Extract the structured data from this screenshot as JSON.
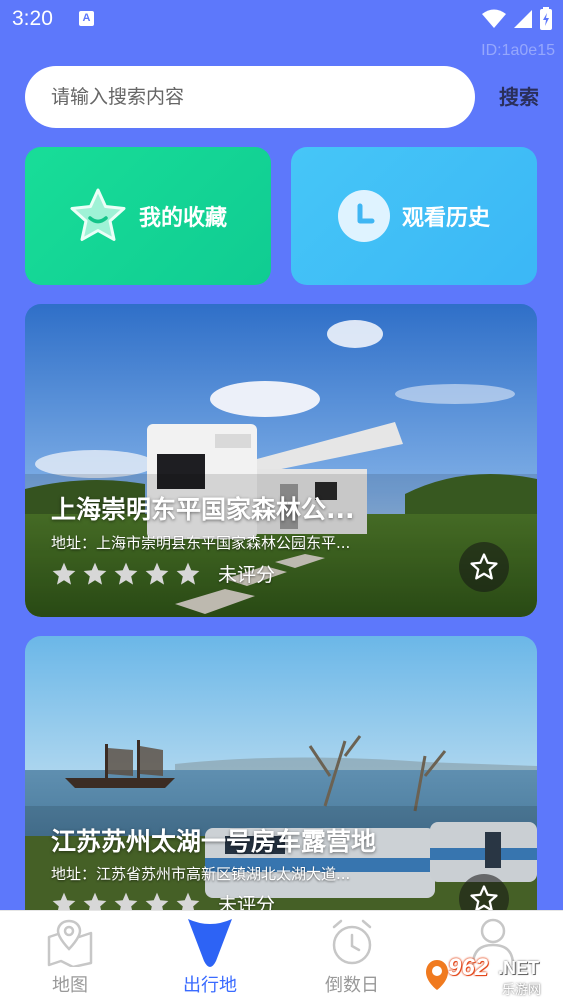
{
  "status_bar": {
    "time": "3:20",
    "notification_letter": "A",
    "icons": [
      "wifi-icon",
      "signal-icon",
      "battery-icon"
    ]
  },
  "device_id": "ID:1a0e15",
  "search": {
    "placeholder": "请输入搜索内容",
    "value": "",
    "button_label": "搜索"
  },
  "quick_actions": {
    "favorites_label": "我的收藏",
    "history_label": "观看历史"
  },
  "campsites": [
    {
      "title": "上海崇明东平国家森林公...",
      "address": "地址：上海市崇明县东平国家森林公园东平...",
      "rating_stars": 0,
      "rating_max": 5,
      "rating_text": "未评分"
    },
    {
      "title": "江苏苏州太湖一号房车露营地",
      "address": "地址：江苏省苏州市高新区镇湖北太湖大道...",
      "rating_stars": 0,
      "rating_max": 5,
      "rating_text": "未评分"
    }
  ],
  "tab_bar": {
    "tabs": [
      {
        "label": "地图",
        "icon": "map-icon",
        "active": false
      },
      {
        "label": "出行地",
        "icon": "location-pin-icon",
        "active": true
      },
      {
        "label": "倒数日",
        "icon": "alarm-clock-icon",
        "active": false
      },
      {
        "label": "",
        "icon": "profile-icon",
        "active": false
      }
    ]
  },
  "watermark": {
    "number": "962",
    "suffix": ".NET",
    "sub": "乐游网"
  },
  "colors": {
    "background": "#5d78fb",
    "favorites_card": "#14d596",
    "history_card": "#40bff7",
    "active_tab": "#3a6bff",
    "inactive_tab": "#999999"
  }
}
